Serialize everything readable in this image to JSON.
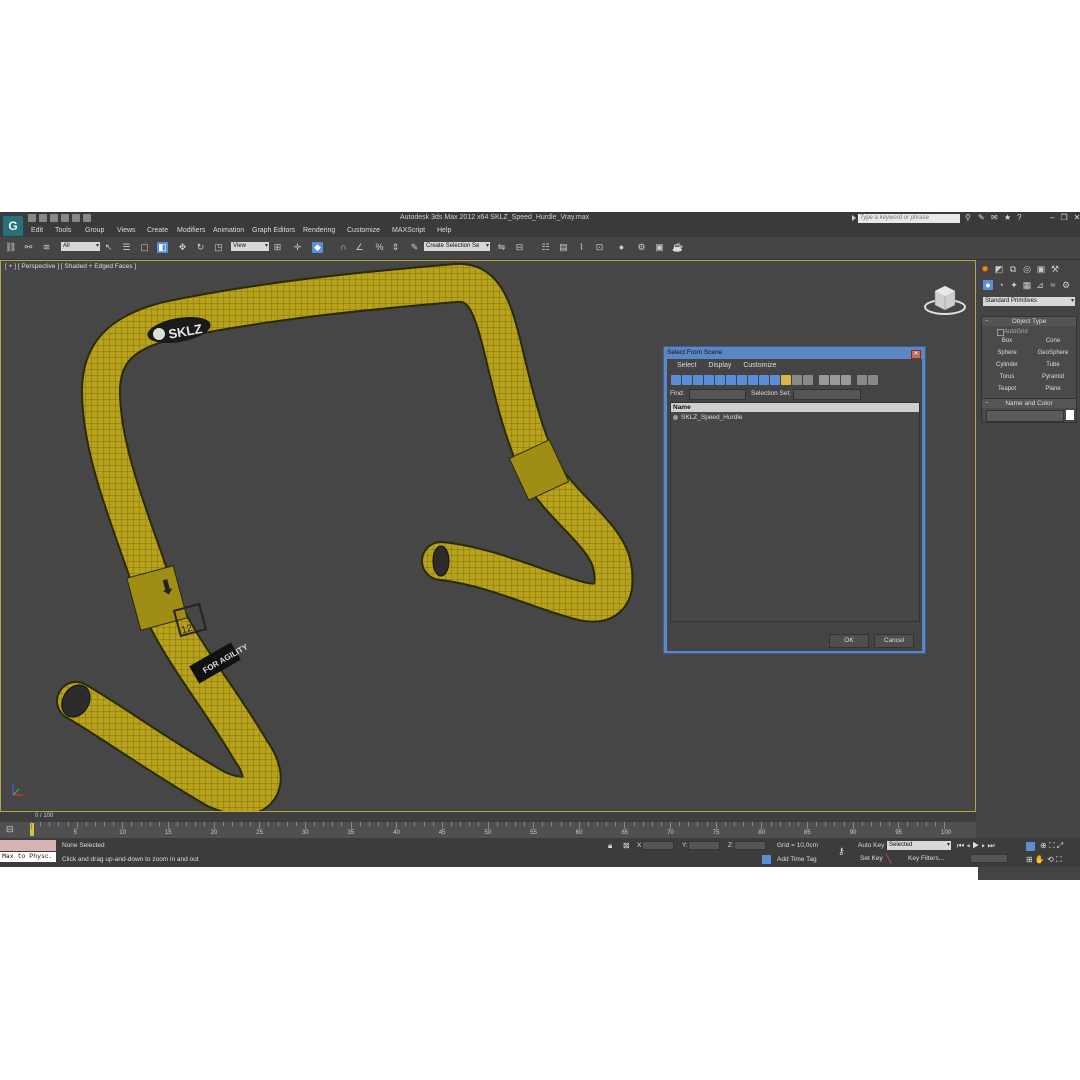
{
  "app": {
    "title": "Autodesk 3ds Max  2012 x64      SKLZ_Speed_Hurdle_Vray.max",
    "search_placeholder": "Type a keyword or phrase",
    "logo_glyph": "G"
  },
  "menu": [
    "Edit",
    "Tools",
    "Group",
    "Views",
    "Create",
    "Modifiers",
    "Animation",
    "Graph Editors",
    "Rendering",
    "Customize",
    "MAXScript",
    "Help"
  ],
  "toolbar": {
    "selection_filter": "All",
    "reference_coord": "View",
    "named_selection": "Create Selection Se"
  },
  "viewport": {
    "label": "[ + ] [ Perspective ] [ Shaded + Edged Faces ]",
    "brand_text": "SKLZ",
    "band_text": "FOR AGILITY",
    "height_number": "12",
    "model_color": "#b8a21a"
  },
  "command_panel": {
    "category": "Standard Primitives",
    "object_type_title": "Object Type",
    "autogrid_label": "AutoGrid",
    "object_types": [
      "Box",
      "Cone",
      "Sphere",
      "GeoSphere",
      "Cylinder",
      "Tube",
      "Torus",
      "Pyramid",
      "Teapot",
      "Plane"
    ],
    "name_color_title": "Name and Color"
  },
  "dialog": {
    "title": "Select From Scene",
    "menu": [
      "Select",
      "Display",
      "Customize"
    ],
    "find_label": "Find:",
    "selection_set_label": "Selection Set:",
    "column_name": "Name",
    "items": [
      "SKLZ_Speed_Hurdle"
    ],
    "ok_label": "OK",
    "cancel_label": "Cancel"
  },
  "timeline": {
    "frame_display": "0 / 100",
    "ticks": [
      "5",
      "10",
      "15",
      "20",
      "25",
      "30",
      "35",
      "40",
      "45",
      "50",
      "55",
      "60",
      "65",
      "70",
      "75",
      "80",
      "85",
      "90",
      "95",
      "100"
    ]
  },
  "status": {
    "maxscript_label": "Max to Physc.",
    "selection_status": "None Selected",
    "prompt": "Click and drag up-and-down to zoom in and out",
    "x_label": "X:",
    "y_label": "Y:",
    "z_label": "Z:",
    "grid": "Grid = 10,0cm",
    "add_time_tag": "Add Time Tag",
    "auto_key": "Auto Key",
    "auto_key_mode": "Selected",
    "set_key": "Set Key",
    "key_filters": "Key Filters..."
  }
}
